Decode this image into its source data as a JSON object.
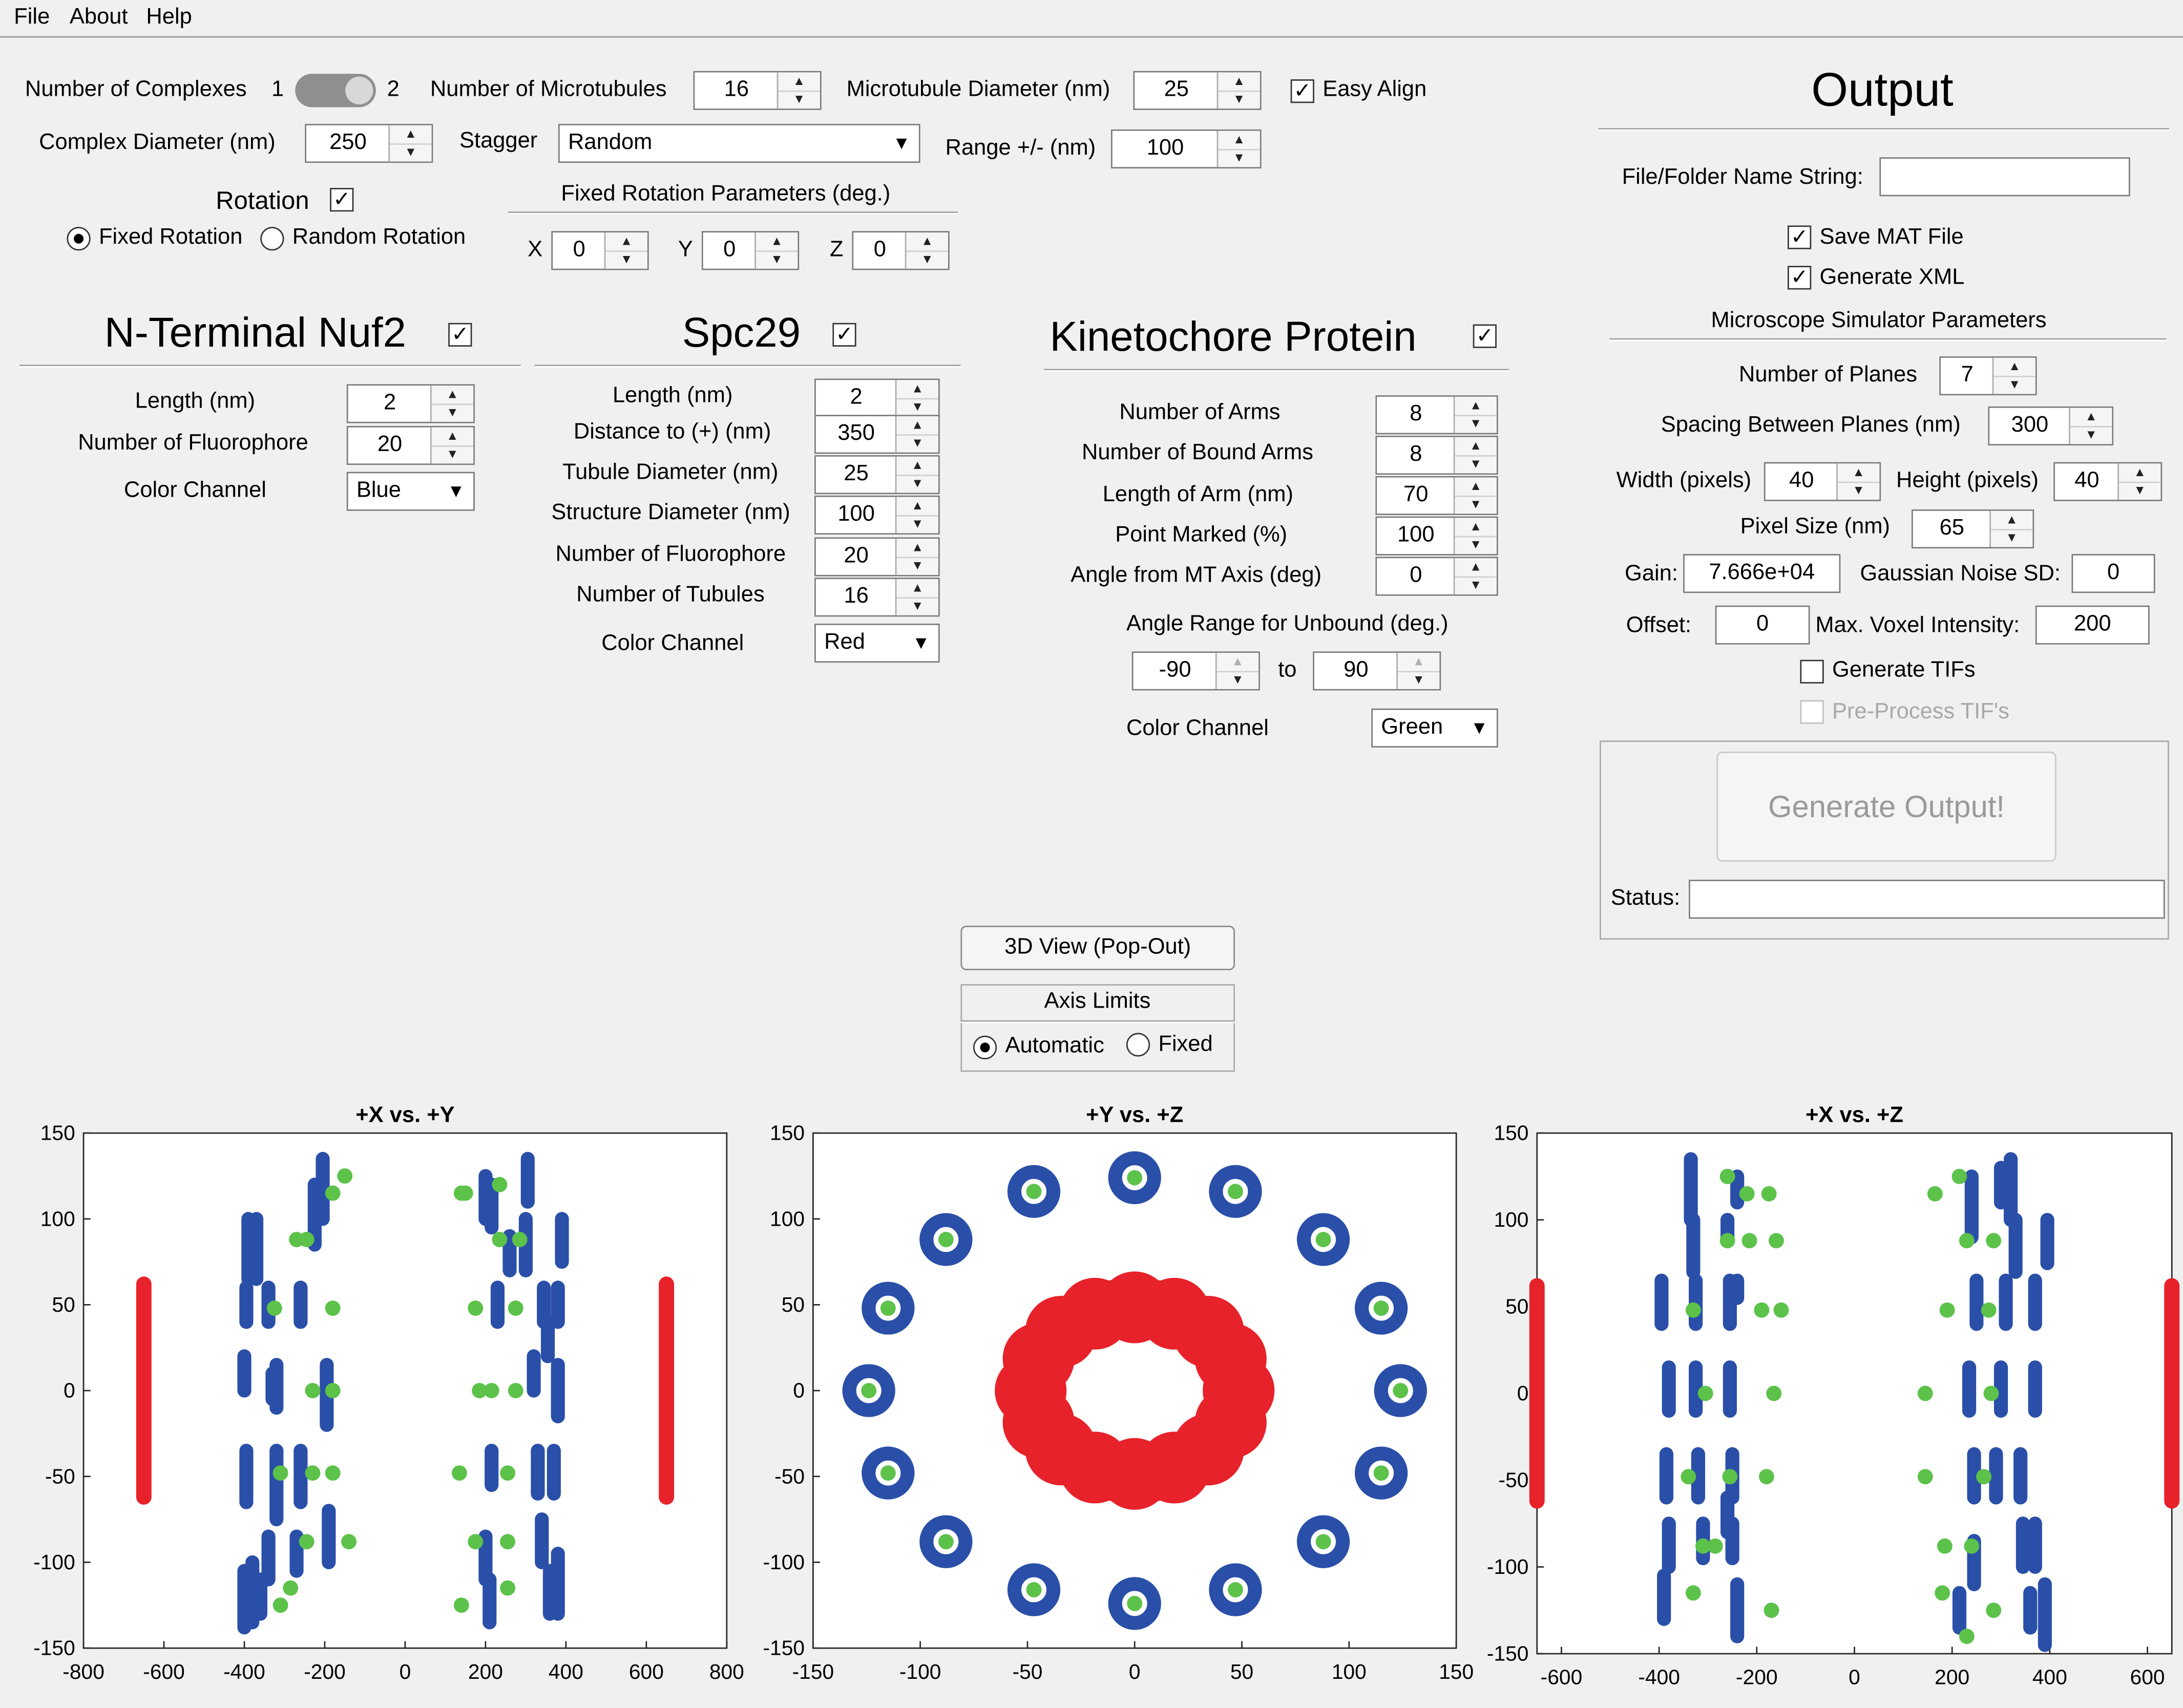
{
  "menu": {
    "file": "File",
    "about": "About",
    "help": "Help"
  },
  "general": {
    "num_complexes_label": "Number of Complexes",
    "num_complexes_opt1": "1",
    "num_complexes_opt2": "2",
    "num_microtubules_label": "Number of Microtubules",
    "num_microtubules_value": "16",
    "mt_diameter_label": "Microtubule Diameter (nm)",
    "mt_diameter_value": "25",
    "easy_align_label": "Easy Align",
    "complex_diameter_label": "Complex Diameter (nm)",
    "complex_diameter_value": "250",
    "stagger_label": "Stagger",
    "stagger_value": "Random",
    "range_label": "Range +/- (nm)",
    "range_value": "100",
    "rotation_label": "Rotation",
    "fixed_rotation_label": "Fixed Rotation",
    "random_rotation_label": "Random Rotation",
    "fixed_params_label": "Fixed Rotation Parameters (deg.)",
    "x_label": "X",
    "x_value": "0",
    "y_label": "Y",
    "y_value": "0",
    "z_label": "Z",
    "z_value": "0"
  },
  "nuf2": {
    "title": "N-Terminal Nuf2",
    "length_label": "Length (nm)",
    "length_value": "2",
    "fluor_label": "Number of Fluorophore",
    "fluor_value": "20",
    "color_label": "Color Channel",
    "color_value": "Blue"
  },
  "spc29": {
    "title": "Spc29",
    "length_label": "Length (nm)",
    "length_value": "2",
    "distance_label": "Distance to (+) (nm)",
    "distance_value": "350",
    "tubule_label": "Tubule Diameter (nm)",
    "tubule_value": "25",
    "structure_label": "Structure Diameter (nm)",
    "structure_value": "100",
    "fluor_label": "Number of Fluorophore",
    "fluor_value": "20",
    "tubules_label": "Number of Tubules",
    "tubules_value": "16",
    "color_label": "Color Channel",
    "color_value": "Red"
  },
  "kinetochore": {
    "title": "Kinetochore Protein",
    "arms_label": "Number of Arms",
    "arms_value": "8",
    "bound_label": "Number of Bound Arms",
    "bound_value": "8",
    "arm_length_label": "Length of Arm (nm)",
    "arm_length_value": "70",
    "marked_label": "Point Marked (%)",
    "marked_value": "100",
    "angle_label": "Angle from MT Axis (deg)",
    "angle_value": "0",
    "range_label": "Angle Range for Unbound (deg.)",
    "range_from": "-90",
    "range_to_label": "to",
    "range_to": "90",
    "color_label": "Color Channel",
    "color_value": "Green"
  },
  "output": {
    "title": "Output",
    "name_label": "File/Folder Name String:",
    "name_value": "",
    "save_mat_label": "Save MAT File",
    "gen_xml_label": "Generate XML",
    "sim_params_label": "Microscope Simulator Parameters",
    "planes_label": "Number of Planes",
    "planes_value": "7",
    "spacing_label": "Spacing Between Planes (nm)",
    "spacing_value": "300",
    "width_label": "Width (pixels)",
    "width_value": "40",
    "height_label": "Height (pixels)",
    "height_value": "40",
    "pixel_label": "Pixel Size (nm)",
    "pixel_value": "65",
    "gain_label": "Gain:",
    "gain_value": "7.666e+04",
    "noise_label": "Gaussian Noise SD:",
    "noise_value": "0",
    "offset_label": "Offset:",
    "offset_value": "0",
    "voxel_label": "Max. Voxel Intensity:",
    "voxel_value": "200",
    "tifs_label": "Generate TIFs",
    "preprocess_label": "Pre-Process TIF's",
    "generate_label": "Generate Output!",
    "status_label": "Status:",
    "status_value": ""
  },
  "view": {
    "popout_label": "3D View (Pop-Out)",
    "axis_limits_label": "Axis Limits",
    "automatic_label": "Automatic",
    "fixed_label": "Fixed"
  },
  "colors": {
    "blue": "#2a4fa8",
    "red": "#e8222a",
    "green": "#5cc24a"
  },
  "chart_data": [
    {
      "type": "scatter",
      "title": "+X vs. +Y",
      "xlim": [
        -800,
        800
      ],
      "ylim": [
        -150,
        150
      ],
      "xticks": [
        "-800",
        "-600",
        "-400",
        "-200",
        "0",
        "200",
        "400",
        "600",
        "800"
      ],
      "yticks": [
        "150",
        "100",
        "50",
        "0",
        "-50",
        "-100",
        "-150"
      ],
      "series": [
        {
          "color": "red",
          "kind": "vertical-line",
          "points": [
            [
              -650,
              -62
            ],
            [
              -650,
              62
            ],
            [
              650,
              -62
            ],
            [
              650,
              62
            ]
          ]
        },
        {
          "color": "blue",
          "kind": "vertical-clusters",
          "clusters": [
            [
              -400,
              -138,
              -105
            ],
            [
              -380,
              -135,
              -100
            ],
            [
              -360,
              -130,
              -110
            ],
            [
              -390,
              65,
              100
            ],
            [
              -370,
              65,
              100
            ],
            [
              -395,
              40,
              60
            ],
            [
              -395,
              -65,
              -35
            ],
            [
              -400,
              0,
              20
            ],
            [
              -330,
              -5,
              10
            ],
            [
              -320,
              -10,
              15
            ],
            [
              -260,
              40,
              60
            ],
            [
              -340,
              40,
              60
            ],
            [
              -320,
              -75,
              -35
            ],
            [
              -260,
              -65,
              -35
            ],
            [
              -340,
              -110,
              -85
            ],
            [
              -270,
              -105,
              -85
            ],
            [
              -225,
              85,
              120
            ],
            [
              -205,
              100,
              135
            ],
            [
              -190,
              -100,
              -70
            ],
            [
              -195,
              -20,
              15
            ],
            [
              200,
              100,
              125
            ],
            [
              215,
              95,
              120
            ],
            [
              200,
              -110,
              -85
            ],
            [
              210,
              -135,
              -110
            ],
            [
              215,
              -55,
              -35
            ],
            [
              230,
              40,
              60
            ],
            [
              260,
              70,
              90
            ],
            [
              300,
              70,
              100
            ],
            [
              305,
              110,
              135
            ],
            [
              320,
              0,
              20
            ],
            [
              330,
              -60,
              -35
            ],
            [
              340,
              -100,
              -75
            ],
            [
              345,
              40,
              60
            ],
            [
              355,
              20,
              40
            ],
            [
              360,
              -130,
              -105
            ],
            [
              370,
              -60,
              -35
            ],
            [
              380,
              -15,
              15
            ],
            [
              390,
              75,
              100
            ],
            [
              380,
              -130,
              -95
            ],
            [
              380,
              40,
              60
            ]
          ]
        },
        {
          "color": "green",
          "points": [
            [
              -150,
              125
            ],
            [
              -180,
              115
            ],
            [
              -245,
              88
            ],
            [
              -270,
              88
            ],
            [
              -325,
              48
            ],
            [
              -180,
              48
            ],
            [
              -310,
              -48
            ],
            [
              -230,
              -48
            ],
            [
              -180,
              -48
            ],
            [
              -245,
              -88
            ],
            [
              -140,
              -88
            ],
            [
              -285,
              -115
            ],
            [
              -310,
              -125
            ],
            [
              -230,
              0
            ],
            [
              -180,
              0
            ],
            [
              140,
              115
            ],
            [
              150,
              115
            ],
            [
              235,
              120
            ],
            [
              235,
              88
            ],
            [
              285,
              88
            ],
            [
              175,
              48
            ],
            [
              275,
              48
            ],
            [
              215,
              0
            ],
            [
              275,
              0
            ],
            [
              135,
              -48
            ],
            [
              255,
              -48
            ],
            [
              175,
              -88
            ],
            [
              255,
              -88
            ],
            [
              140,
              -125
            ],
            [
              255,
              -115
            ],
            [
              185,
              0
            ]
          ]
        }
      ]
    },
    {
      "type": "scatter",
      "title": "+Y vs. +Z",
      "xlim": [
        -150,
        150
      ],
      "ylim": [
        -150,
        150
      ],
      "xticks": [
        "-150",
        "-100",
        "-50",
        "0",
        "50",
        "100",
        "150"
      ],
      "yticks": [
        "150",
        "100",
        "50",
        "0",
        "-50",
        "-100",
        "-150"
      ],
      "series": [
        {
          "color": "red",
          "kind": "ring",
          "center": [
            0,
            0
          ],
          "r_inner": 35,
          "r_outer": 62
        },
        {
          "color": "blue",
          "kind": "ring-markers",
          "points": [
            [
              0,
              124
            ],
            [
              47,
              116
            ],
            [
              88,
              88
            ],
            [
              115,
              48
            ],
            [
              124,
              0
            ],
            [
              115,
              -48
            ],
            [
              88,
              -88
            ],
            [
              47,
              -116
            ],
            [
              0,
              -124
            ],
            [
              -47,
              -116
            ],
            [
              -88,
              -88
            ],
            [
              -115,
              -48
            ],
            [
              -124,
              0
            ],
            [
              -115,
              48
            ],
            [
              -88,
              88
            ],
            [
              -47,
              116
            ]
          ]
        },
        {
          "color": "green",
          "points": [
            [
              0,
              124
            ],
            [
              47,
              116
            ],
            [
              88,
              88
            ],
            [
              115,
              48
            ],
            [
              124,
              0
            ],
            [
              115,
              -48
            ],
            [
              88,
              -88
            ],
            [
              47,
              -116
            ],
            [
              0,
              -124
            ],
            [
              -47,
              -116
            ],
            [
              -88,
              -88
            ],
            [
              -115,
              -48
            ],
            [
              -124,
              0
            ],
            [
              -115,
              48
            ],
            [
              -88,
              88
            ],
            [
              -47,
              116
            ]
          ]
        }
      ]
    },
    {
      "type": "scatter",
      "title": "+X vs. +Z",
      "xlim": [
        -650,
        650
      ],
      "ylim": [
        -150,
        150
      ],
      "xticks": [
        "-600",
        "-400",
        "-200",
        "0",
        "200",
        "400",
        "600"
      ],
      "yticks": [
        "150",
        "100",
        "50",
        "0",
        "-50",
        "-100",
        "-150"
      ],
      "series": [
        {
          "color": "red",
          "kind": "vertical-line",
          "points": [
            [
              -650,
              -62
            ],
            [
              -650,
              62
            ],
            [
              650,
              -62
            ],
            [
              650,
              62
            ]
          ]
        },
        {
          "color": "blue",
          "kind": "vertical-clusters",
          "clusters": [
            [
              -395,
              40,
              65
            ],
            [
              -390,
              -130,
              -105
            ],
            [
              -380,
              -10,
              15
            ],
            [
              -385,
              -60,
              -35
            ],
            [
              -380,
              -100,
              -75
            ],
            [
              -335,
              100,
              135
            ],
            [
              -330,
              70,
              100
            ],
            [
              -325,
              -10,
              15
            ],
            [
              -320,
              -60,
              -35
            ],
            [
              -310,
              -95,
              -75
            ],
            [
              -325,
              40,
              65
            ],
            [
              -260,
              -80,
              -60
            ],
            [
              -255,
              40,
              65
            ],
            [
              -260,
              90,
              100
            ],
            [
              -255,
              -10,
              15
            ],
            [
              -250,
              -60,
              -35
            ],
            [
              -250,
              -95,
              -75
            ],
            [
              -240,
              -140,
              -110
            ],
            [
              -240,
              110,
              125
            ],
            [
              -240,
              55,
              65
            ],
            [
              250,
              40,
              65
            ],
            [
              240,
              90,
              125
            ],
            [
              235,
              -10,
              15
            ],
            [
              245,
              -60,
              -35
            ],
            [
              245,
              -110,
              -85
            ],
            [
              215,
              -135,
              -115
            ],
            [
              320,
              100,
              135
            ],
            [
              300,
              110,
              130
            ],
            [
              290,
              -60,
              -35
            ],
            [
              300,
              -10,
              15
            ],
            [
              310,
              40,
              65
            ],
            [
              330,
              70,
              100
            ],
            [
              345,
              -100,
              -75
            ],
            [
              340,
              -60,
              -35
            ],
            [
              370,
              -10,
              15
            ],
            [
              370,
              40,
              65
            ],
            [
              370,
              -100,
              -75
            ],
            [
              390,
              -145,
              -110
            ],
            [
              395,
              75,
              100
            ],
            [
              360,
              -135,
              -115
            ]
          ]
        },
        {
          "color": "green",
          "points": [
            [
              -260,
              125
            ],
            [
              -220,
              115
            ],
            [
              -260,
              88
            ],
            [
              -215,
              88
            ],
            [
              -330,
              48
            ],
            [
              -190,
              48
            ],
            [
              -340,
              -48
            ],
            [
              -255,
              -48
            ],
            [
              -180,
              -48
            ],
            [
              -310,
              -88
            ],
            [
              -285,
              -88
            ],
            [
              -330,
              -115
            ],
            [
              -170,
              -125
            ],
            [
              -305,
              0
            ],
            [
              -165,
              0
            ],
            [
              -150,
              48
            ],
            [
              -160,
              88
            ],
            [
              -175,
              115
            ],
            [
              165,
              115
            ],
            [
              215,
              125
            ],
            [
              230,
              88
            ],
            [
              285,
              88
            ],
            [
              190,
              48
            ],
            [
              275,
              48
            ],
            [
              145,
              0
            ],
            [
              280,
              0
            ],
            [
              145,
              -48
            ],
            [
              265,
              -48
            ],
            [
              185,
              -88
            ],
            [
              240,
              -88
            ],
            [
              180,
              -115
            ],
            [
              285,
              -125
            ],
            [
              230,
              -140
            ]
          ]
        }
      ]
    }
  ]
}
